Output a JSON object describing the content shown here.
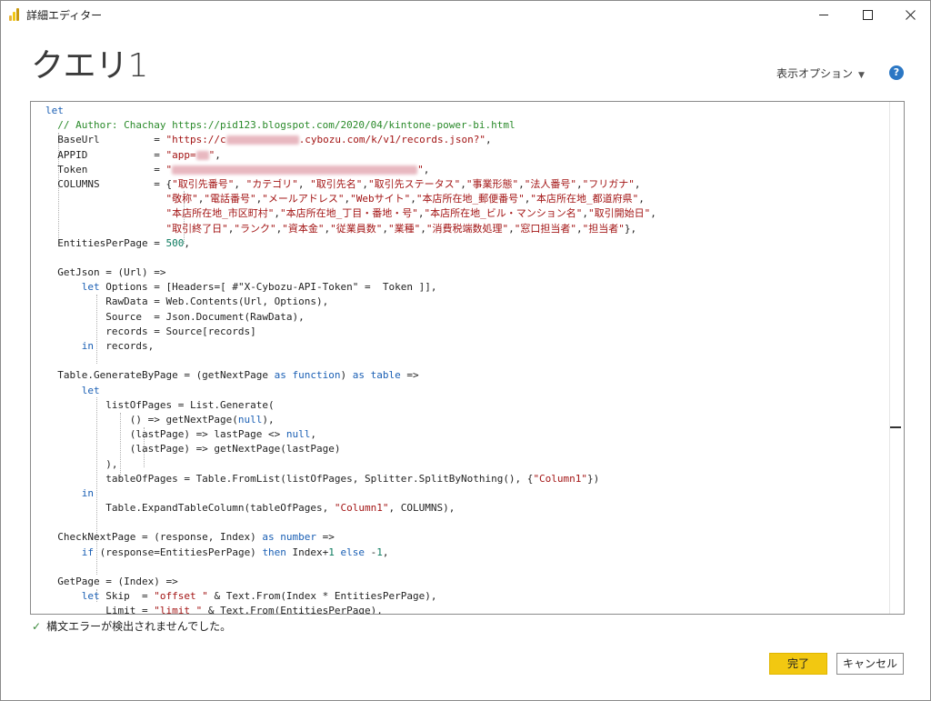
{
  "window": {
    "title": "詳細エディター"
  },
  "header": {
    "query_name": "クエリ",
    "query_number": "1",
    "display_options": "表示オプション"
  },
  "editor": {
    "lines": [
      [
        {
          "t": "let",
          "c": "kw"
        }
      ],
      [
        {
          "t": "  "
        },
        {
          "t": "// Author: Chachay https://pid123.blogspot.com/2020/04/kintone-power-bi.html",
          "c": "cm"
        }
      ],
      [
        {
          "t": "  BaseUrl         = "
        },
        {
          "t": "\"https://c",
          "c": "str"
        },
        {
          "blur": 80
        },
        {
          "t": ".cybozu.com/k/v1/records.json?\"",
          "c": "str"
        },
        {
          "t": ","
        }
      ],
      [
        {
          "t": "  APPID           = "
        },
        {
          "t": "\"app=",
          "c": "str"
        },
        {
          "blur": 14
        },
        {
          "t": "\"",
          "c": "str"
        },
        {
          "t": ","
        }
      ],
      [
        {
          "t": "  Token           = "
        },
        {
          "t": "\"",
          "c": "str"
        },
        {
          "blur": 270
        },
        {
          "t": "\"",
          "c": "str"
        },
        {
          "t": ","
        }
      ],
      [
        {
          "t": "  COLUMNS         = {"
        },
        {
          "t": "\"取引先番号\"",
          "c": "str"
        },
        {
          "t": ", "
        },
        {
          "t": "\"カテゴリ\"",
          "c": "str"
        },
        {
          "t": ", "
        },
        {
          "t": "\"取引先名\"",
          "c": "str"
        },
        {
          "t": ","
        },
        {
          "t": "\"取引先ステータス\"",
          "c": "str"
        },
        {
          "t": ","
        },
        {
          "t": "\"事業形態\"",
          "c": "str"
        },
        {
          "t": ","
        },
        {
          "t": "\"法人番号\"",
          "c": "str"
        },
        {
          "t": ","
        },
        {
          "t": "\"フリガナ\"",
          "c": "str"
        },
        {
          "t": ","
        }
      ],
      [
        {
          "t": "                    "
        },
        {
          "t": "\"敬称\"",
          "c": "str"
        },
        {
          "t": ","
        },
        {
          "t": "\"電話番号\"",
          "c": "str"
        },
        {
          "t": ","
        },
        {
          "t": "\"メールアドレス\"",
          "c": "str"
        },
        {
          "t": ","
        },
        {
          "t": "\"Webサイト\"",
          "c": "str"
        },
        {
          "t": ","
        },
        {
          "t": "\"本店所在地_郵便番号\"",
          "c": "str"
        },
        {
          "t": ","
        },
        {
          "t": "\"本店所在地_都道府県\"",
          "c": "str"
        },
        {
          "t": ","
        }
      ],
      [
        {
          "t": "                    "
        },
        {
          "t": "\"本店所在地_市区町村\"",
          "c": "str"
        },
        {
          "t": ","
        },
        {
          "t": "\"本店所在地_丁目・番地・号\"",
          "c": "str"
        },
        {
          "t": ","
        },
        {
          "t": "\"本店所在地_ビル・マンション名\"",
          "c": "str"
        },
        {
          "t": ","
        },
        {
          "t": "\"取引開始日\"",
          "c": "str"
        },
        {
          "t": ","
        }
      ],
      [
        {
          "t": "                    "
        },
        {
          "t": "\"取引終了日\"",
          "c": "str"
        },
        {
          "t": ","
        },
        {
          "t": "\"ランク\"",
          "c": "str"
        },
        {
          "t": ","
        },
        {
          "t": "\"資本金\"",
          "c": "str"
        },
        {
          "t": ","
        },
        {
          "t": "\"従業員数\"",
          "c": "str"
        },
        {
          "t": ","
        },
        {
          "t": "\"業種\"",
          "c": "str"
        },
        {
          "t": ","
        },
        {
          "t": "\"消費税端数処理\"",
          "c": "str"
        },
        {
          "t": ","
        },
        {
          "t": "\"窓口担当者\"",
          "c": "str"
        },
        {
          "t": ","
        },
        {
          "t": "\"担当者\"",
          "c": "str"
        },
        {
          "t": "},"
        }
      ],
      [
        {
          "t": "  EntitiesPerPage = "
        },
        {
          "t": "500",
          "c": "num"
        },
        {
          "t": ","
        }
      ],
      [
        {
          "t": ""
        }
      ],
      [
        {
          "t": "  GetJson = (Url) =>"
        }
      ],
      [
        {
          "t": "      "
        },
        {
          "t": "let",
          "c": "kw"
        },
        {
          "t": " Options = [Headers=[ #\"X-Cybozu-API-Token\" =  Token ]],"
        }
      ],
      [
        {
          "t": "          RawData = Web.Contents(Url, Options),"
        }
      ],
      [
        {
          "t": "          Source  = Json.Document(RawData),"
        }
      ],
      [
        {
          "t": "          records = Source[records]"
        }
      ],
      [
        {
          "t": "      "
        },
        {
          "t": "in",
          "c": "kw"
        },
        {
          "t": "  records,"
        }
      ],
      [
        {
          "t": ""
        }
      ],
      [
        {
          "t": "  Table.GenerateByPage = (getNextPage "
        },
        {
          "t": "as",
          "c": "kw"
        },
        {
          "t": " "
        },
        {
          "t": "function",
          "c": "kw"
        },
        {
          "t": ") "
        },
        {
          "t": "as",
          "c": "kw"
        },
        {
          "t": " "
        },
        {
          "t": "table",
          "c": "kw"
        },
        {
          "t": " =>"
        }
      ],
      [
        {
          "t": "      "
        },
        {
          "t": "let",
          "c": "kw"
        }
      ],
      [
        {
          "t": "          listOfPages = List.Generate("
        }
      ],
      [
        {
          "t": "              () => getNextPage("
        },
        {
          "t": "null",
          "c": "kw"
        },
        {
          "t": "),"
        }
      ],
      [
        {
          "t": "              (lastPage) => lastPage <> "
        },
        {
          "t": "null",
          "c": "kw"
        },
        {
          "t": ","
        }
      ],
      [
        {
          "t": "              (lastPage) => getNextPage(lastPage)"
        }
      ],
      [
        {
          "t": "          ),"
        }
      ],
      [
        {
          "t": "          tableOfPages = Table.FromList(listOfPages, Splitter.SplitByNothing(), {"
        },
        {
          "t": "\"Column1\"",
          "c": "str"
        },
        {
          "t": "})"
        }
      ],
      [
        {
          "t": "      "
        },
        {
          "t": "in",
          "c": "kw"
        }
      ],
      [
        {
          "t": "          Table.ExpandTableColumn(tableOfPages, "
        },
        {
          "t": "\"Column1\"",
          "c": "str"
        },
        {
          "t": ", COLUMNS),"
        }
      ],
      [
        {
          "t": ""
        }
      ],
      [
        {
          "t": "  CheckNextPage = (response, Index) "
        },
        {
          "t": "as",
          "c": "kw"
        },
        {
          "t": " "
        },
        {
          "t": "number",
          "c": "kw"
        },
        {
          "t": " =>"
        }
      ],
      [
        {
          "t": "      "
        },
        {
          "t": "if",
          "c": "kw"
        },
        {
          "t": " (response=EntitiesPerPage) "
        },
        {
          "t": "then",
          "c": "kw"
        },
        {
          "t": " Index+"
        },
        {
          "t": "1",
          "c": "num"
        },
        {
          "t": " "
        },
        {
          "t": "else",
          "c": "kw"
        },
        {
          "t": " -"
        },
        {
          "t": "1",
          "c": "num"
        },
        {
          "t": ","
        }
      ],
      [
        {
          "t": ""
        }
      ],
      [
        {
          "t": "  GetPage = (Index) =>"
        }
      ],
      [
        {
          "t": "      "
        },
        {
          "t": "let",
          "c": "kw"
        },
        {
          "t": " Skip  = "
        },
        {
          "t": "\"offset \"",
          "c": "str"
        },
        {
          "t": " & Text.From(Index * EntitiesPerPage),"
        }
      ],
      [
        {
          "t": "          Limit = "
        },
        {
          "t": "\"limit \"",
          "c": "str"
        },
        {
          "t": " & Text.From(EntitiesPerPage),"
        }
      ]
    ]
  },
  "status": {
    "message": "構文エラーが検出されませんでした。"
  },
  "buttons": {
    "done": "完了",
    "cancel": "キャンセル"
  },
  "colors": {
    "keyword": "#1a5fb4",
    "string": "#a31515",
    "comment": "#2a8a2a",
    "number": "#0b7a5e",
    "accent": "#f2c811"
  }
}
